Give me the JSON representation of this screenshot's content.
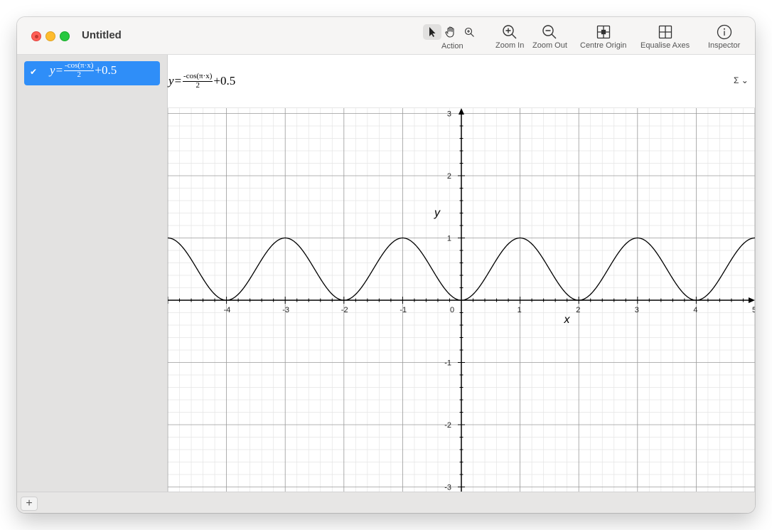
{
  "window": {
    "title": "Untitled"
  },
  "toolbar": {
    "action_label": "Action",
    "zoom_in_label": "Zoom In",
    "zoom_out_label": "Zoom Out",
    "centre_origin_label": "Centre Origin",
    "equalise_axes_label": "Equalise Axes",
    "inspector_label": "Inspector"
  },
  "equations": [
    {
      "lhs": "y=",
      "numerator": "-cos(π·x)",
      "denominator": "2",
      "rhs": "+0.5",
      "enabled": true
    }
  ],
  "header": {
    "lhs": "y=",
    "numerator": "-cos(π·x)",
    "denominator": "2",
    "rhs": "+0.5",
    "sigma": "Σ ⌄"
  },
  "colors": {
    "selection": "#2f8ef8",
    "curve": "#000000",
    "grid_major": "#9a9a9a",
    "grid_minor": "#e4e4e4"
  },
  "bottom": {
    "add_label": "+"
  },
  "chart_data": {
    "type": "line",
    "series": [
      {
        "x": [
          -5,
          -4.75,
          -4.5,
          -4.25,
          -4,
          -3.75,
          -3.5,
          -3.25,
          -3,
          -2.75,
          -2.5,
          -2.25,
          -2,
          -1.75,
          -1.5,
          -1.25,
          -1,
          -0.75,
          -0.5,
          -0.25,
          0,
          0.25,
          0.5,
          0.75,
          1,
          1.25,
          1.5,
          1.75,
          2,
          2.25,
          2.5,
          2.75,
          3,
          3.25,
          3.5,
          3.75,
          4,
          4.25,
          4.5,
          4.75,
          5
        ],
        "y": [
          1,
          0.854,
          0.5,
          0.146,
          0,
          0.146,
          0.5,
          0.854,
          1,
          0.854,
          0.5,
          0.146,
          0,
          0.146,
          0.5,
          0.854,
          1,
          0.854,
          0.5,
          0.146,
          0,
          0.146,
          0.5,
          0.854,
          1,
          0.854,
          0.5,
          0.146,
          0,
          0.146,
          0.5,
          0.854,
          1,
          0.854,
          0.5,
          0.146,
          0,
          0.146,
          0.5,
          0.854,
          1
        ]
      }
    ],
    "xlabel": "x",
    "ylabel": "y",
    "xlim": [
      -5,
      5
    ],
    "ylim": [
      -3,
      3
    ],
    "x_ticks": [
      "-4",
      "-3",
      "-2",
      "-1",
      "0",
      "1",
      "2",
      "3",
      "4",
      "5"
    ],
    "y_ticks": [
      "-3",
      "-2",
      "-1",
      "1",
      "2",
      "3"
    ],
    "grid": true
  }
}
